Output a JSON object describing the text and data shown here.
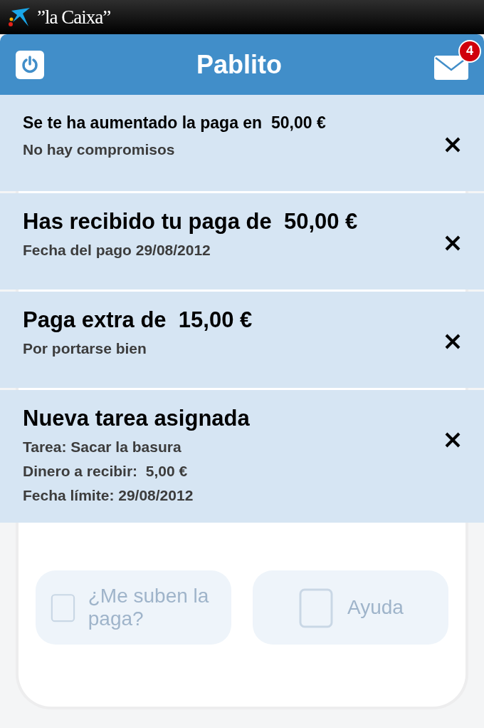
{
  "status_bar": {
    "brand": "”la Caixa”"
  },
  "header": {
    "title": "Pablito",
    "unread_count": "4"
  },
  "notifications": [
    {
      "kind": "compact",
      "title": "Se te ha aumentado la paga en  50,00 €",
      "details": [
        "No hay compromisos"
      ]
    },
    {
      "kind": "standard",
      "title": "Has recibido tu paga de  50,00 €",
      "details": [
        "Fecha del pago 29/08/2012"
      ]
    },
    {
      "kind": "standard",
      "title": "Paga extra de  15,00 €",
      "details": [
        "Por portarse bien"
      ]
    },
    {
      "kind": "standard",
      "title": "Nueva tarea asignada",
      "details": [
        "Tarea: Sacar la basura",
        "Dinero a recibir:  5,00 €",
        "Fecha límite: 29/08/2012"
      ]
    }
  ],
  "background_menu": [
    {
      "label": "¿Me suben la paga?"
    },
    {
      "label": "Ayuda"
    }
  ]
}
